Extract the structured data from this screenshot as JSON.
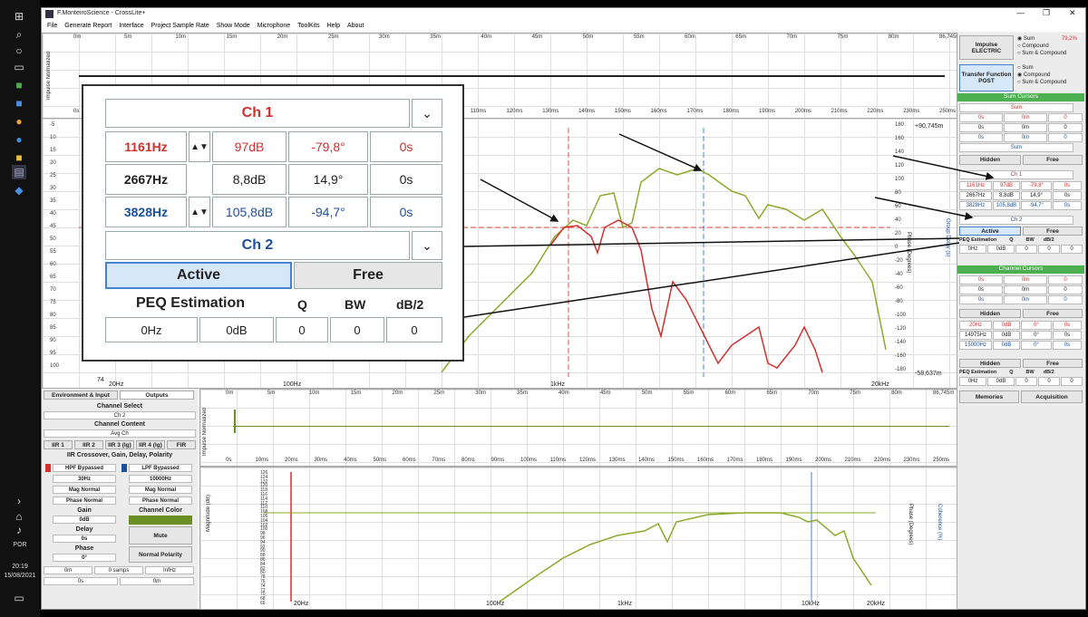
{
  "taskbar": {
    "language": "POR",
    "time": "20:19",
    "date": "15/08/2021"
  },
  "window": {
    "title": "F.MonteiroScience - CrossLite+"
  },
  "menu": [
    "File",
    "Generate Report",
    "Interface",
    "Project Sample Rate",
    "Show Mode",
    "Microphone",
    "ToolKits",
    "Help",
    "About"
  ],
  "top_impulse": {
    "ylabel": "Impulse Normalized",
    "top_ticks": [
      "0m",
      "5m",
      "10m",
      "15m",
      "20m",
      "25m",
      "30m",
      "35m",
      "40m",
      "45m",
      "50m",
      "55m",
      "60m",
      "65m",
      "70m",
      "75m",
      "80m",
      "86,745m"
    ],
    "bottom_ticks": [
      "0s",
      "10ms",
      "20ms",
      "30ms",
      "40ms",
      "50ms",
      "60ms",
      "70ms",
      "80ms",
      "90ms",
      "100ms",
      "110ms",
      "120ms",
      "130ms",
      "140ms",
      "150ms",
      "160ms",
      "170ms",
      "180ms",
      "190ms",
      "200ms",
      "210ms",
      "220ms",
      "230ms",
      "250ms"
    ]
  },
  "main_chart": {
    "right_top": "+90,745m",
    "right_bottom": "-58,637m",
    "phase_label": "Phase (Degrees)",
    "delay_label": "Group Delay (s)",
    "phase_ticks": [
      "180",
      "160",
      "140",
      "120",
      "100",
      "80",
      "60",
      "40",
      "20",
      "0",
      "-20",
      "-40",
      "-60",
      "-80",
      "-100",
      "-120",
      "-140",
      "-160",
      "-180"
    ],
    "left_ticks": [
      "-5",
      "10",
      "15",
      "20",
      "25",
      "30",
      "35",
      "40",
      "45",
      "50",
      "55",
      "60",
      "65",
      "70",
      "75",
      "80",
      "85",
      "90",
      "95",
      "100"
    ],
    "x_ticks": [
      "20Hz",
      "100Hz",
      "1kHz",
      "20kHz"
    ],
    "mag_label": "74"
  },
  "zoom": {
    "ch1_title": "Ch 1",
    "rows": [
      {
        "freq": "1161Hz",
        "gain": "97dB",
        "phase": "-79,8°",
        "delay": "0s",
        "color": "red"
      },
      {
        "freq": "2667Hz",
        "gain": "8,8dB",
        "phase": "14,9°",
        "delay": "0s",
        "color": "dark"
      },
      {
        "freq": "3828Hz",
        "gain": "105,8dB",
        "phase": "-94,7°",
        "delay": "0s",
        "color": "blue"
      }
    ],
    "ch2_title": "Ch 2",
    "active": "Active",
    "free": "Free",
    "peq": {
      "title": "PEQ Estimation",
      "q": "Q",
      "bw": "BW",
      "db2": "dB/2",
      "freq_val": "0Hz",
      "gain_val": "0dB",
      "q_val": "0",
      "bw_val": "0",
      "db2_val": "0"
    }
  },
  "right_panel": {
    "impulse_btn": "Impulse ELECTRIC",
    "transfer_btn": "Transfer Function POST",
    "radio1": [
      "Sum",
      "Compound",
      "Sum & Compound"
    ],
    "radio2": [
      "Sum",
      "Compound",
      "Sum & Compound"
    ],
    "percent": "79,2%",
    "sum_cursors": "Sum Cursors",
    "sum_label": "Sum",
    "sum_rows": [
      [
        "0s",
        "0m",
        "0"
      ],
      [
        "0s",
        "0m",
        "0"
      ],
      [
        "0s",
        "0m",
        "0"
      ]
    ],
    "sum2_label": "Sum",
    "hidden": "Hidden",
    "free": "Free",
    "ch1": "Ch 1",
    "ch_rows": [
      [
        "1161Hz",
        "97dB",
        "-79,8°",
        "0s"
      ],
      [
        "2667Hz",
        "8,8dB",
        "14,9°",
        "0s"
      ],
      [
        "3828Hz",
        "105,8dB",
        "-94,7°",
        "0s"
      ]
    ],
    "ch2": "Ch 2",
    "active": "Active",
    "peq": [
      "PEQ Estimation",
      "Q",
      "BW",
      "dB/2"
    ],
    "peq_vals": [
      "0Hz",
      "0dB",
      "0",
      "0",
      "0"
    ],
    "channel_cursors": "Channel Cursors",
    "cc_rows": [
      [
        "0s",
        "0m",
        "0"
      ],
      [
        "0s",
        "0m",
        "0"
      ],
      [
        "0s",
        "0m",
        "0"
      ]
    ],
    "hidden2": "Hidden",
    "free2": "Free",
    "cc_freq_rows": [
      [
        "20Hz",
        "0dB",
        "0°",
        "0s"
      ],
      [
        "14975Hz",
        "0dB",
        "0°",
        "0s"
      ],
      [
        "15000Hz",
        "0dB",
        "0°",
        "0s"
      ]
    ],
    "hidden3": "Hidden",
    "free3": "Free",
    "peq2": [
      "PEQ Estimation",
      "Q",
      "BW",
      "dB/2"
    ],
    "peq2_vals": [
      "0Hz",
      "0dB",
      "0",
      "0",
      "0"
    ],
    "memories": "Memories",
    "acquisition": "Acquisition"
  },
  "left_panel": {
    "tab1": "Environment & Input",
    "tab2": "Outputs",
    "channel_select": "Channel Select",
    "channel_value": "Ch 2",
    "channel_content": "Channel Content",
    "content_value": "Avg Ch",
    "iir_tabs": [
      "IIR 1",
      "IIR 2",
      "IIR 3 (lg)",
      "IIR 4 (lg)",
      "FIR"
    ],
    "section_title": "IIR Crossover, Gain, Delay, Polarity",
    "hpf": "HPF Bypassed",
    "hpf_freq": "30Hz",
    "lpf": "LPF Bypassed",
    "lpf_freq": "10000Hz",
    "mag1": "Mag Normal",
    "mag2": "Mag Normal",
    "phase1": "Phase Normal",
    "phase2": "Phase Normal",
    "gain": "Gain",
    "gain_val": "0dB",
    "channel_color": "Channel Color",
    "channel_color_hex": "#6b8e23",
    "delay": "Delay",
    "delay_val": "0s",
    "mute": "Mute",
    "phase": "Phase",
    "phase_val": "0°",
    "polarity": "Normal Polarity",
    "bottom_row": [
      "0m",
      "0 samps",
      "InfHz"
    ],
    "bottom_row2": [
      "0s",
      "0m"
    ]
  },
  "bottom_impulse": {
    "ylabel": "Impulse Normalized",
    "top_ticks": [
      "0m",
      "5m",
      "10m",
      "15m",
      "20m",
      "25m",
      "30m",
      "35m",
      "40m",
      "45m",
      "50m",
      "55m",
      "60m",
      "65m",
      "70m",
      "75m",
      "80m",
      "86,745m"
    ],
    "bottom_ticks": [
      "0s",
      "10ms",
      "20ms",
      "30ms",
      "40ms",
      "50ms",
      "60ms",
      "70ms",
      "80ms",
      "90ms",
      "100ms",
      "110ms",
      "120ms",
      "130ms",
      "140ms",
      "150ms",
      "160ms",
      "170ms",
      "180ms",
      "190ms",
      "200ms",
      "210ms",
      "220ms",
      "230ms",
      "250ms"
    ]
  },
  "bottom_chart": {
    "mag_label": "Magnitude (dB)",
    "phase_label": "Phase (Degrees)",
    "coh_label": "Coherence (%)",
    "mag_ticks": [
      "126",
      "124",
      "122",
      "120",
      "118",
      "116",
      "114",
      "112",
      "110",
      "108",
      "106",
      "104",
      "102",
      "100",
      "98",
      "96",
      "94",
      "92",
      "90",
      "88",
      "86",
      "84",
      "82",
      "80",
      "78",
      "76",
      "74",
      "72",
      "70",
      "68",
      "66"
    ],
    "x_ticks": [
      "20Hz",
      "100Hz",
      "1kHz",
      "10kHz",
      "20kHz"
    ]
  }
}
